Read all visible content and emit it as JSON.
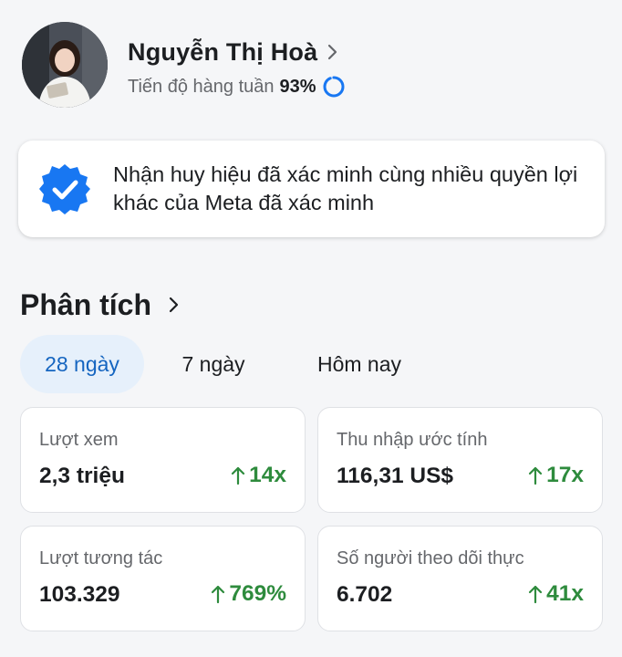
{
  "profile": {
    "name": "Nguyễn Thị Hoà",
    "progress_label": "Tiến độ hàng tuần",
    "progress_value": "93%",
    "progress_fraction": 0.93
  },
  "banner": {
    "text": "Nhận huy hiệu đã xác minh cùng nhiều quyền lợi khác của Meta đã xác minh"
  },
  "analytics": {
    "title": "Phân tích",
    "tabs": [
      {
        "label": "28 ngày",
        "active": true
      },
      {
        "label": "7 ngày",
        "active": false
      },
      {
        "label": "Hôm nay",
        "active": false
      }
    ],
    "cards": [
      {
        "label": "Lượt xem",
        "value": "2,3 triệu",
        "change": "14x"
      },
      {
        "label": "Thu nhập ước tính",
        "value": "116,31 US$",
        "change": "17x"
      },
      {
        "label": "Lượt tương tác",
        "value": "103.329",
        "change": "769%"
      },
      {
        "label": "Số người theo dõi thực",
        "value": "6.702",
        "change": "41x"
      }
    ]
  },
  "colors": {
    "accent_blue": "#1565c0",
    "active_tab_bg": "#e6f0fb",
    "positive_green": "#2e8b3d",
    "verified_badge": "#1877f2"
  },
  "icons": {
    "avatar": "profile-photo",
    "profile_chevron": "chevron-right-icon",
    "progress": "progress-ring-icon",
    "banner_badge": "verified-badge-icon",
    "change_arrow": "arrow-up-icon"
  }
}
